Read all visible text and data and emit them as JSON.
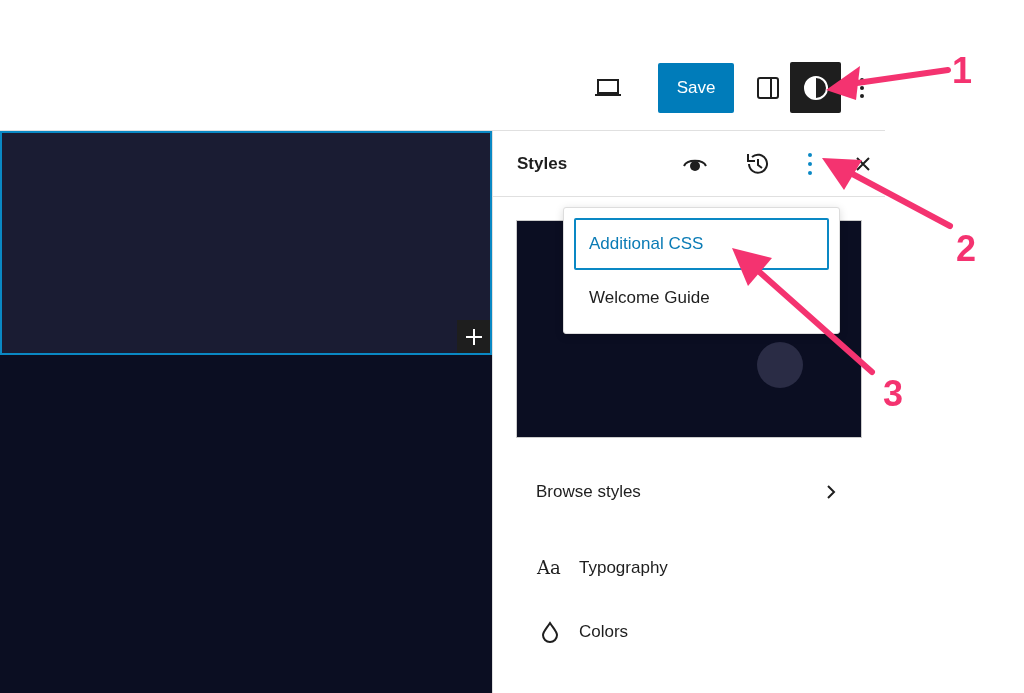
{
  "toolbar": {
    "save_label": "Save",
    "styles_toggle": {
      "selected": true
    }
  },
  "canvas": {
    "block_selected": true
  },
  "styles_panel": {
    "title": "Styles",
    "options_selected": true,
    "menu": [
      {
        "label": "Additional CSS",
        "selected": true
      },
      {
        "label": "Welcome Guide",
        "selected": false
      }
    ],
    "browse_label": "Browse styles",
    "items": [
      {
        "kind": "typography",
        "label": "Typography",
        "icon_text": "Aa"
      },
      {
        "kind": "colors",
        "label": "Colors"
      }
    ]
  },
  "annotations": [
    "1",
    "2",
    "3"
  ]
}
